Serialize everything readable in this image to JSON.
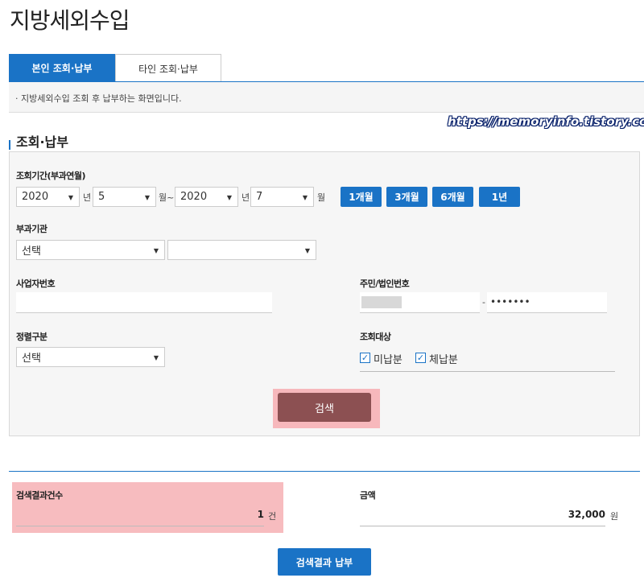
{
  "page": {
    "title": "지방세외수입"
  },
  "tabs": [
    {
      "label": "본인 조회·납부",
      "active": true
    },
    {
      "label": "타인 조회·납부",
      "active": false
    }
  ],
  "notice": "· 지방세외수입 조회 후 납부하는 화면입니다.",
  "watermark": "https://memoryinfo.tistory.com",
  "section": {
    "title": "조회·납부"
  },
  "form": {
    "period": {
      "label": "조회기간(부과연월)",
      "start_year": "2020",
      "year_unit": "년",
      "start_month": "5",
      "month_unit_tilde": "월~",
      "end_year": "2020",
      "end_month": "7",
      "month_unit": "월",
      "quick_buttons": [
        "1개월",
        "3개월",
        "6개월",
        "1년"
      ]
    },
    "agency": {
      "label": "부과기관",
      "select1": "선택",
      "select2": ""
    },
    "business_no": {
      "label": "사업자번호",
      "value": ""
    },
    "resident_no": {
      "label": "주민/법인번호",
      "front": "",
      "separator": "-",
      "back": "•••••••"
    },
    "sort": {
      "label": "정렬구분",
      "value": "선택"
    },
    "target": {
      "label": "조회대상",
      "options": [
        {
          "label": "미납분",
          "checked": true,
          "mark": "✓"
        },
        {
          "label": "체납분",
          "checked": true,
          "mark": "✓"
        }
      ]
    },
    "search_button": "검색"
  },
  "result": {
    "count_label": "검색결과건수",
    "count_value": "1",
    "count_unit": "건",
    "amount_label": "금액",
    "amount_value": "32,000",
    "amount_unit": "원",
    "pay_button": "검색결과 납부"
  },
  "colors": {
    "accent": "#1a73c6",
    "search_button": "#8c5052",
    "highlight": "#f7b8bc"
  }
}
